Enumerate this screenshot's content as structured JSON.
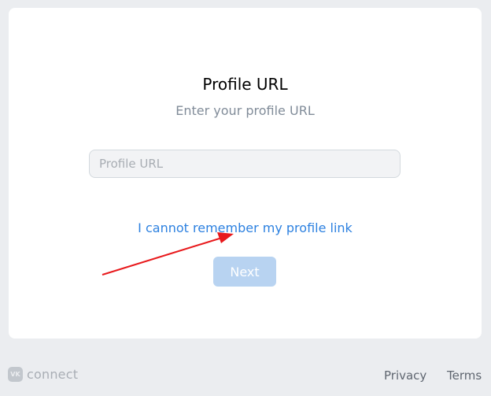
{
  "card": {
    "title": "Profile URL",
    "subtitle": "Enter your profile URL",
    "input_placeholder": "Profile URL",
    "input_value": "",
    "forgot_link": "I cannot remember my profile link",
    "next_label": "Next"
  },
  "footer": {
    "logo_text": "connect",
    "logo_icon": "vk-logo-icon",
    "privacy_label": "Privacy",
    "terms_label": "Terms"
  },
  "colors": {
    "background": "#ebedf0",
    "card": "#ffffff",
    "link": "#2d81e0",
    "button_disabled": "#b8d3f1",
    "annotation_arrow": "#e8191c"
  }
}
